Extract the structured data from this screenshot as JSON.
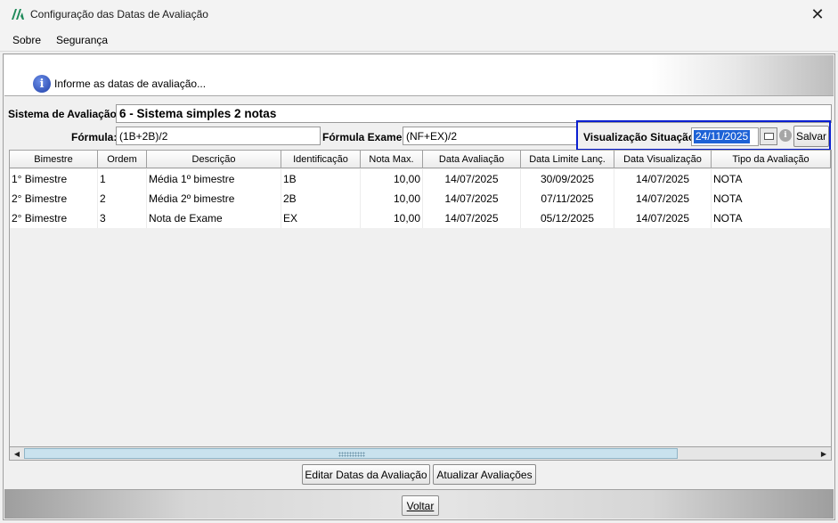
{
  "window": {
    "title": "Configuração das Datas de Avaliação",
    "close_glyph": "✕"
  },
  "menu": {
    "items": [
      "Sobre",
      "Segurança"
    ]
  },
  "info": {
    "text": "Informe as datas de avaliação..."
  },
  "form": {
    "sistema_label": "Sistema de Avaliação:",
    "sistema_value": "6 - Sistema simples 2 notas",
    "formula_label": "Fórmula:",
    "formula_value": "(1B+2B)/2",
    "formula_exame_label": "Fórmula Exame:",
    "formula_exame_value": "(NF+EX)/2",
    "visualizacao_label": "Visualização Situação:",
    "visualizacao_value": "24/11/2025",
    "salvar_label": "Salvar"
  },
  "table": {
    "columns": [
      "Bimestre",
      "Ordem",
      "Descrição",
      "Identificação",
      "Nota Max.",
      "Data Avaliação",
      "Data Limite Lanç.",
      "Data Visualização",
      "Tipo da Avaliação"
    ],
    "rows": [
      [
        "1° Bimestre",
        "1",
        "Média 1º bimestre",
        "1B",
        "10,00",
        "14/07/2025",
        "30/09/2025",
        "14/07/2025",
        "NOTA"
      ],
      [
        "2° Bimestre",
        "2",
        "Média 2º bimestre",
        "2B",
        "10,00",
        "14/07/2025",
        "07/11/2025",
        "14/07/2025",
        "NOTA"
      ],
      [
        "2° Bimestre",
        "3",
        "Nota de Exame",
        "EX",
        "10,00",
        "14/07/2025",
        "05/12/2025",
        "14/07/2025",
        "NOTA"
      ]
    ]
  },
  "buttons": {
    "editar": "Editar Datas da Avaliação",
    "atualizar": "Atualizar Avaliações",
    "voltar": "Voltar"
  }
}
